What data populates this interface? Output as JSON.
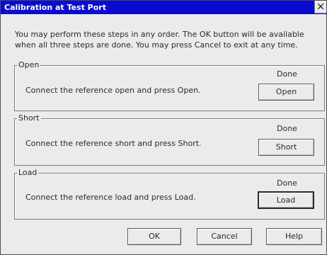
{
  "window": {
    "title": "Calibration at Test Port"
  },
  "instructions": "You may perform these steps in any order. The OK button will be available when all three steps are done. You may press Cancel to exit at any time.",
  "groups": {
    "open": {
      "label": "Open",
      "status": "Done",
      "instruction": "Connect the reference open and press Open.",
      "button": "Open"
    },
    "short": {
      "label": "Short",
      "status": "Done",
      "instruction": "Connect the reference short and press Short.",
      "button": "Short"
    },
    "load": {
      "label": "Load",
      "status": "Done",
      "instruction": "Connect the reference load and press Load.",
      "button": "Load"
    }
  },
  "footer": {
    "ok": "OK",
    "cancel": "Cancel",
    "help": "Help"
  },
  "icons": {
    "close": "close-icon"
  },
  "colors": {
    "titlebar": "#0b0bd0",
    "title_text": "#ffffff",
    "window_bg": "#ebebeb"
  }
}
